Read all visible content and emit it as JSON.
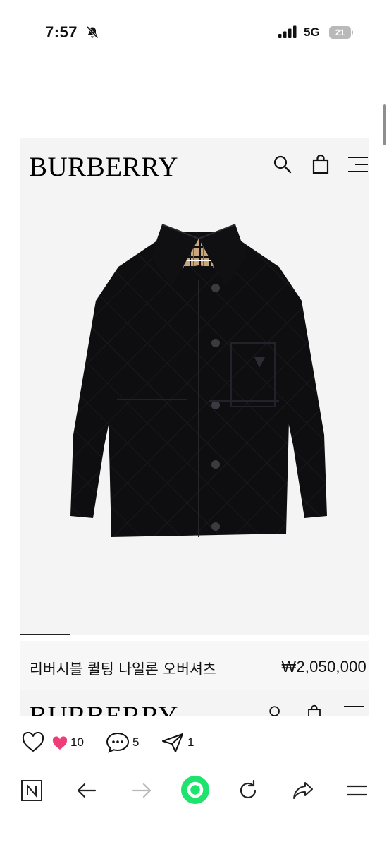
{
  "status_bar": {
    "time": "7:57",
    "network": "5G",
    "battery": "21"
  },
  "product_card": {
    "brand": "BURBERRY",
    "icons": [
      "search-icon",
      "shopping-bag-icon",
      "menu-icon"
    ],
    "image_subject": "black quilted jacket"
  },
  "product": {
    "name": "리버시블 퀼팅 나일론 오버셔츠",
    "price": "₩2,050,000"
  },
  "next_card": {
    "brand": "BURBERRY"
  },
  "reactions": {
    "hearts_count": "10",
    "comments_count": "5",
    "shares_count": "1"
  },
  "toolbar": {
    "icons": [
      "naver-n-icon",
      "back-arrow-icon",
      "forward-arrow-icon",
      "home-circle-icon",
      "reload-icon",
      "share-icon",
      "menu-icon"
    ]
  },
  "colors": {
    "accent_green": "#1ee36d",
    "heart_pink": "#ee3e79",
    "card_bg": "#f4f4f4"
  }
}
